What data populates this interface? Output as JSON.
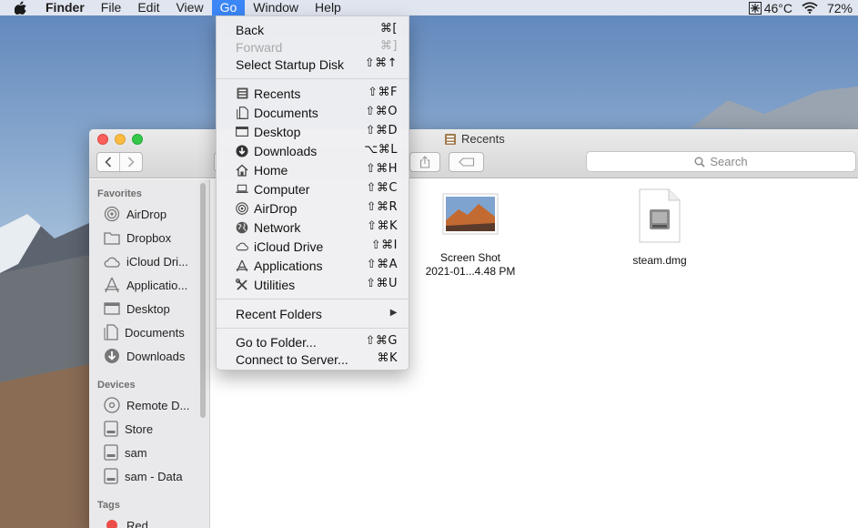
{
  "menubar": {
    "apple": "",
    "app": "Finder",
    "items": [
      "File",
      "Edit",
      "View",
      "Go",
      "Window",
      "Help"
    ],
    "active": "Go",
    "temperature": "46°C",
    "battery": "72%"
  },
  "go_menu": {
    "back": {
      "label": "Back",
      "shortcut": "⌘["
    },
    "forward": {
      "label": "Forward",
      "shortcut": "⌘]"
    },
    "startup": {
      "label": "Select Startup Disk",
      "shortcut": "⇧⌘↑"
    },
    "recents": {
      "label": "Recents",
      "shortcut": "⇧⌘F"
    },
    "documents": {
      "label": "Documents",
      "shortcut": "⇧⌘O"
    },
    "desktop": {
      "label": "Desktop",
      "shortcut": "⇧⌘D"
    },
    "downloads": {
      "label": "Downloads",
      "shortcut": "⌥⌘L"
    },
    "home": {
      "label": "Home",
      "shortcut": "⇧⌘H"
    },
    "computer": {
      "label": "Computer",
      "shortcut": "⇧⌘C"
    },
    "airdrop": {
      "label": "AirDrop",
      "shortcut": "⇧⌘R"
    },
    "network": {
      "label": "Network",
      "shortcut": "⇧⌘K"
    },
    "icloud": {
      "label": "iCloud Drive",
      "shortcut": "⇧⌘I"
    },
    "applications": {
      "label": "Applications",
      "shortcut": "⇧⌘A"
    },
    "utilities": {
      "label": "Utilities",
      "shortcut": "⇧⌘U"
    },
    "recent_folders": {
      "label": "Recent Folders",
      "shortcut": "▶"
    },
    "go_to_folder": {
      "label": "Go to Folder...",
      "shortcut": "⇧⌘G"
    },
    "connect": {
      "label": "Connect to Server...",
      "shortcut": "⌘K"
    }
  },
  "window": {
    "title": "Recents",
    "search_placeholder": "Search"
  },
  "sidebar": {
    "favorites_header": "Favorites",
    "favorites": [
      "AirDrop",
      "Dropbox",
      "iCloud Dri...",
      "Applicatio...",
      "Desktop",
      "Documents",
      "Downloads"
    ],
    "devices_header": "Devices",
    "devices": [
      "Remote D...",
      "Store",
      "sam",
      "sam - Data"
    ],
    "tags_header": "Tags",
    "tags": [
      "Red"
    ]
  },
  "files": [
    {
      "line1": "Screen Shot",
      "line2": "2021-01...4.48 PM"
    },
    {
      "line1": "steam.dmg",
      "line2": ""
    }
  ],
  "colors": {
    "menu_highlight": "#3b87f7",
    "close": "#fc605c",
    "minimize": "#fdbc40",
    "maximize": "#34c84a",
    "tag_red": "#ec4d48"
  }
}
